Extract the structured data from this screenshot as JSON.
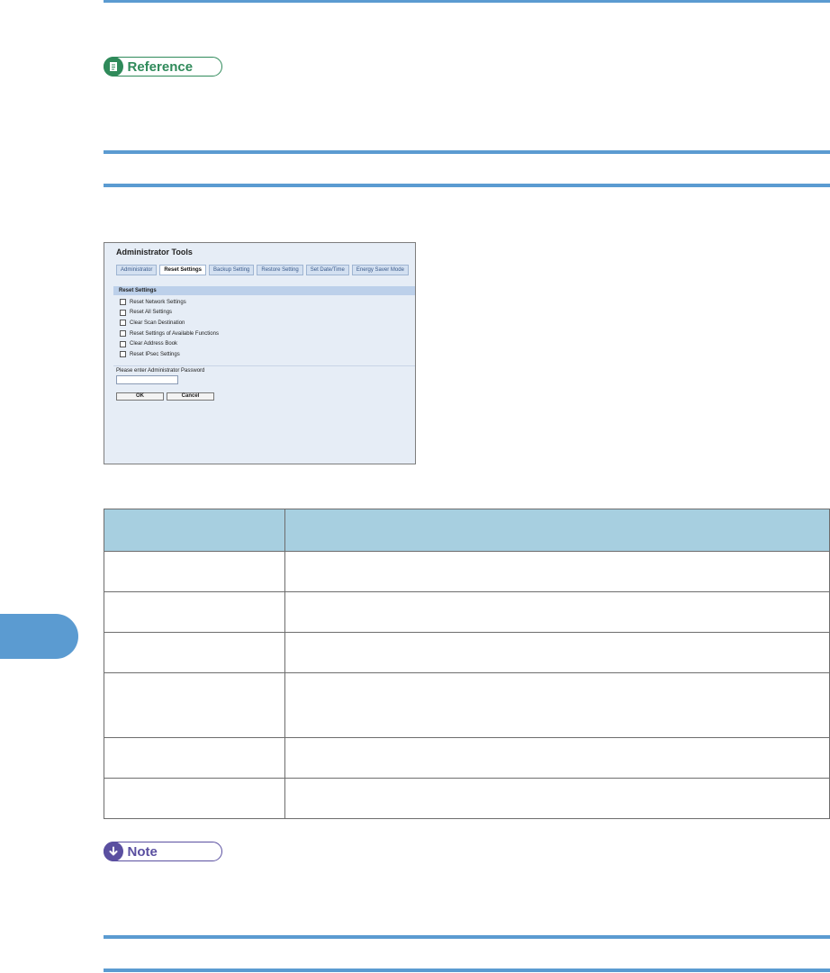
{
  "badges": {
    "reference": "Reference",
    "note": "Note"
  },
  "admin_tools": {
    "title": "Administrator Tools",
    "tabs": [
      "Administrator",
      "Reset Settings",
      "Backup Setting",
      "Restore Setting",
      "Set Date/Time",
      "Energy Saver Mode"
    ],
    "active_tab": "Reset Settings",
    "section_title": "Reset Settings",
    "options": [
      "Reset Network Settings",
      "Reset All Settings",
      "Clear Scan Destination",
      "Reset Settings of Available Functions",
      "Clear Address Book",
      "Reset IPsec Settings"
    ],
    "password_label": "Please enter Administrator Password",
    "ok_label": "OK",
    "cancel_label": "Cancel"
  },
  "table": {
    "headers": [
      "",
      ""
    ],
    "rows": [
      [
        "",
        ""
      ],
      [
        "",
        ""
      ],
      [
        "",
        ""
      ],
      [
        "",
        ""
      ],
      [
        "",
        ""
      ],
      [
        "",
        ""
      ]
    ]
  },
  "colors": {
    "rule": "#5b9bd1",
    "reference": "#2f8a5a",
    "note": "#5a4fa0",
    "table_header": "#a7cfe0",
    "panel_bg": "#e6edf6"
  }
}
